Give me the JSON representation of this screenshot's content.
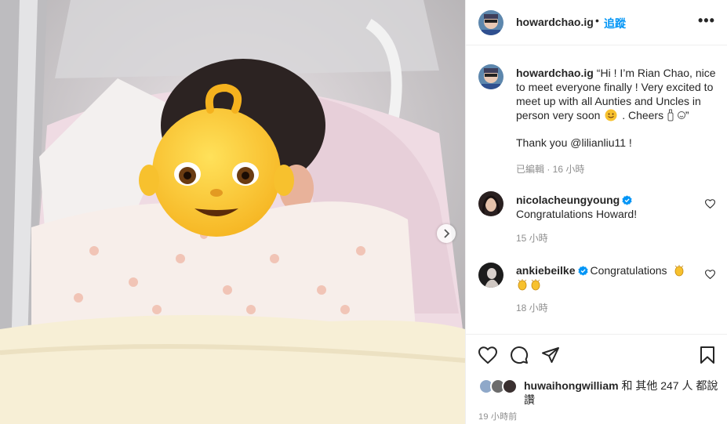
{
  "photo": {
    "alt_icon": "baby-emoji-icon",
    "next_icon": "chevron-right-icon"
  },
  "header": {
    "username": "howardchao.ig",
    "dot": "•",
    "follow": "追蹤",
    "more": "•••"
  },
  "caption": {
    "username": "howardchao.ig",
    "text_part1": "“Hi ! I’m Rian Chao, nice to meet everyone finally ! Very excited to meet up with all Aunties and Uncles in person very soon",
    "text_part2": ". Cheers",
    "text_end": "”",
    "thanks": "Thank you @lilianliu11 !",
    "meta": "已編輯 · 16 小時"
  },
  "comments": [
    {
      "username": "nicolacheungyoung",
      "text": "Congratulations Howard!",
      "time": "15 小時"
    },
    {
      "username": "ankiebeilke",
      "text": "Congratulations",
      "time": "18 小時"
    }
  ],
  "likes": {
    "user": "huwaihongwilliam",
    "text": "和 其他 247 人 都說讚"
  },
  "posted": "19 小時前",
  "colors": {
    "link": "#0095f6",
    "muted": "#8e8e8e",
    "border": "#efefef",
    "verified": "#0095f6"
  }
}
